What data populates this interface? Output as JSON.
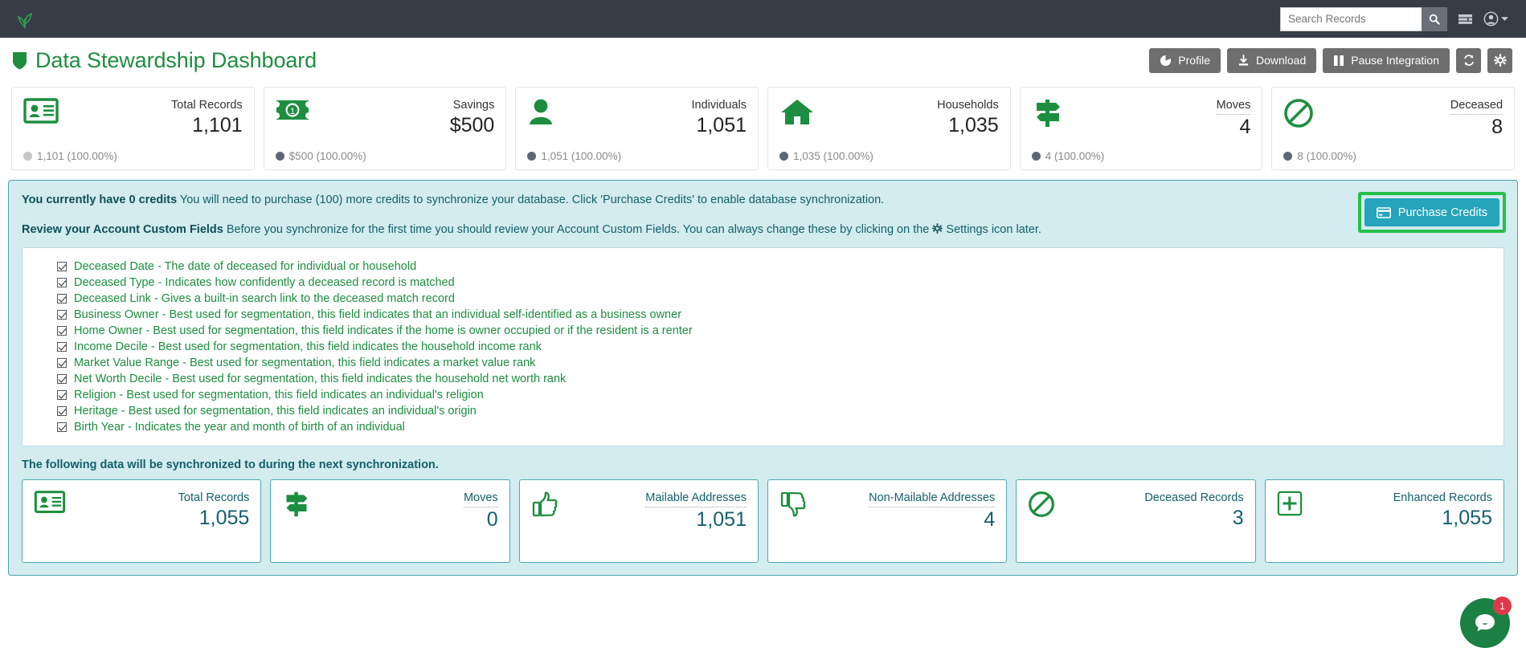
{
  "navbar": {
    "logo_icon": "sprout-leaf-logo",
    "search": {
      "placeholder": "Search Records",
      "value": ""
    },
    "search_icon": "search-icon",
    "grid_icon": "apps-grid-icon",
    "account_icon": "user-account-icon",
    "caret_icon": "chevron-down-icon"
  },
  "header": {
    "shield_icon": "shield-icon",
    "title": "Data Stewardship Dashboard",
    "buttons": [
      {
        "label": "Profile",
        "icon": "pie-chart-icon"
      },
      {
        "label": "Download",
        "icon": "download-icon"
      },
      {
        "label": "Pause Integration",
        "icon": "pause-icon"
      }
    ],
    "refresh_icon": "refresh-icon",
    "settings_icon": "gear-icon"
  },
  "stats": [
    {
      "icon": "id-card-icon",
      "label": "Total Records",
      "value": "1,101",
      "foot": "1,101 (100.00%)",
      "dot_color": "#c6c6c6",
      "dotted": false
    },
    {
      "icon": "money-bill-icon",
      "label": "Savings",
      "value": "$500",
      "foot": "$500 (100.00%)",
      "dot_color": "#5d6674",
      "dotted": false
    },
    {
      "icon": "person-icon",
      "label": "Individuals",
      "value": "1,051",
      "foot": "1,051 (100.00%)",
      "dot_color": "#5d6674",
      "dotted": false
    },
    {
      "icon": "house-icon",
      "label": "Households",
      "value": "1,035",
      "foot": "1,035 (100.00%)",
      "dot_color": "#5d6674",
      "dotted": false
    },
    {
      "icon": "signpost-icon",
      "label": "Moves",
      "value": "4",
      "foot": "4 (100.00%)",
      "dot_color": "#5d6674",
      "dotted": true
    },
    {
      "icon": "no-entry-icon",
      "label": "Deceased",
      "value": "8",
      "foot": "8 (100.00%)",
      "dot_color": "#5d6674",
      "dotted": true
    }
  ],
  "info": {
    "credits_bold": "You currently have 0 credits",
    "credits_rest": " You will need to purchase (100) more credits to synchronize your database. Click 'Purchase Credits' to enable database synchronization.",
    "review_bold": "Review your Account Custom Fields",
    "review_rest_a": " Before you synchronize for the first time you should review your Account Custom Fields. You can always change these by clicking on the ",
    "review_gear_icon": "gear-icon",
    "review_rest_b": " Settings icon later.",
    "purchase_button": {
      "label": "Purchase Credits",
      "icon": "credit-card-icon",
      "bg": "#25a4bb",
      "highlight": "#25c04a"
    }
  },
  "custom_fields": [
    {
      "checked": true,
      "text": "Deceased Date - The date of deceased for individual or household"
    },
    {
      "checked": true,
      "text": "Deceased Type - Indicates how confidently a deceased record is matched"
    },
    {
      "checked": true,
      "text": "Deceased Link - Gives a built-in search link to the deceased match record"
    },
    {
      "checked": true,
      "text": "Business Owner - Best used for segmentation, this field indicates that an individual self-identified as a business owner"
    },
    {
      "checked": true,
      "text": "Home Owner - Best used for segmentation, this field indicates if the home is owner occupied or if the resident is a renter"
    },
    {
      "checked": true,
      "text": "Income Decile - Best used for segmentation, this field indicates the household income rank"
    },
    {
      "checked": true,
      "text": "Market Value Range - Best used for segmentation, this field indicates a market value rank"
    },
    {
      "checked": true,
      "text": "Net Worth Decile - Best used for segmentation, this field indicates the household net worth rank"
    },
    {
      "checked": true,
      "text": "Religion - Best used for segmentation, this field indicates an individual's religion"
    },
    {
      "checked": true,
      "text": "Heritage - Best used for segmentation, this field indicates an individual's origin"
    },
    {
      "checked": true,
      "text": "Birth Year - Indicates the year and month of birth of an individual"
    }
  ],
  "sync": {
    "title": "The following data will be synchronized to  during the next synchronization.",
    "cards": [
      {
        "icon": "id-card-icon",
        "label": "Total Records",
        "value": "1,055",
        "dotted": false
      },
      {
        "icon": "signpost-icon",
        "label": "Moves",
        "value": "0",
        "dotted": true
      },
      {
        "icon": "thumbs-up-icon",
        "label": "Mailable Addresses",
        "value": "1,051",
        "dotted": true
      },
      {
        "icon": "thumbs-down-icon",
        "label": "Non-Mailable Addresses",
        "value": "4",
        "dotted": true
      },
      {
        "icon": "no-entry-icon",
        "label": "Deceased Records",
        "value": "3",
        "dotted": false
      },
      {
        "icon": "plus-square-icon",
        "label": "Enhanced Records",
        "value": "1,055",
        "dotted": false
      }
    ]
  },
  "chat": {
    "icon": "chat-bubble-icon",
    "badge": "1",
    "bg": "#1a8043",
    "badge_bg": "#e0384a"
  }
}
